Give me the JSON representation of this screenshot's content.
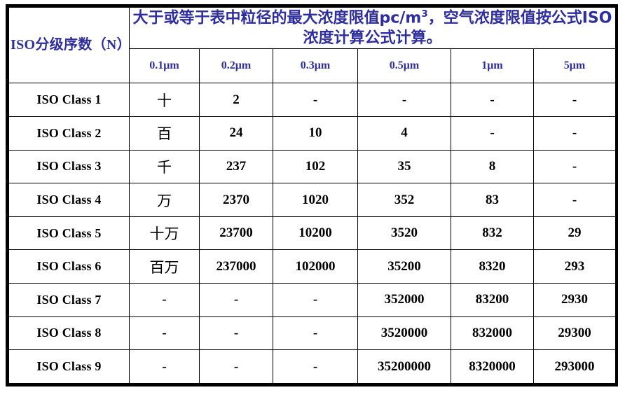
{
  "table": {
    "header": {
      "class_column_label": "ISO分级序数（N）",
      "note": "大于或等于表中粒径的最大浓度限值pc/m",
      "note_sup": "3",
      "note_tail": "，空气浓度限值按公式ISO浓度计算公式计算。",
      "size_columns": [
        "0.1μm",
        "0.2μm",
        "0.3μm",
        "0.5μm",
        "1μm",
        "5μm"
      ]
    },
    "colors": {
      "header_text": "#2e2ea0",
      "body_text": "#000000",
      "border": "#000000",
      "background": "#ffffff"
    },
    "rows": [
      {
        "label": "ISO Class 1",
        "cells": [
          "十",
          "2",
          "-",
          "-",
          "-",
          "-"
        ],
        "kinds": [
          "cn",
          "num",
          "num",
          "num",
          "num",
          "num"
        ]
      },
      {
        "label": "ISO Class 2",
        "cells": [
          "百",
          "24",
          "10",
          "4",
          "-",
          "-"
        ],
        "kinds": [
          "cn",
          "num",
          "num",
          "num",
          "num",
          "num"
        ]
      },
      {
        "label": "ISO Class 3",
        "cells": [
          "千",
          "237",
          "102",
          "35",
          "8",
          "-"
        ],
        "kinds": [
          "cn",
          "num",
          "num",
          "num",
          "num",
          "num"
        ]
      },
      {
        "label": "ISO Class 4",
        "cells": [
          "万",
          "2370",
          "1020",
          "352",
          "83",
          "-"
        ],
        "kinds": [
          "cn",
          "num",
          "num",
          "num",
          "num",
          "num"
        ]
      },
      {
        "label": "ISO Class 5",
        "cells": [
          "十万",
          "23700",
          "10200",
          "3520",
          "832",
          "29"
        ],
        "kinds": [
          "cn",
          "num",
          "num",
          "num",
          "num",
          "num"
        ]
      },
      {
        "label": "ISO Class 6",
        "cells": [
          "百万",
          "237000",
          "102000",
          "35200",
          "8320",
          "293"
        ],
        "kinds": [
          "cn",
          "num",
          "num",
          "num",
          "num",
          "num"
        ]
      },
      {
        "label": "ISO Class 7",
        "cells": [
          "-",
          "-",
          "-",
          "352000",
          "83200",
          "2930"
        ],
        "kinds": [
          "dashleft",
          "dashmid",
          "dashmid",
          "num",
          "num",
          "num"
        ]
      },
      {
        "label": "ISO Class 8",
        "cells": [
          "-",
          "-",
          "-",
          "3520000",
          "832000",
          "29300"
        ],
        "kinds": [
          "dashleft",
          "dashmid",
          "dashmid",
          "num",
          "num",
          "num"
        ]
      },
      {
        "label": "ISO Class 9",
        "cells": [
          "-",
          "-",
          "-",
          "35200000",
          "8320000",
          "293000"
        ],
        "kinds": [
          "dashleft",
          "dashmid",
          "dashmid",
          "num",
          "num",
          "num"
        ]
      }
    ]
  }
}
